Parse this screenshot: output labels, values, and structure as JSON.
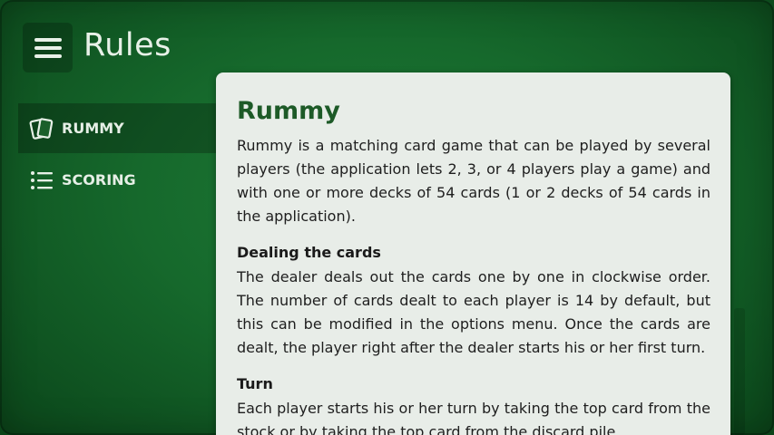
{
  "header": {
    "menu_icon": "hamburger-icon",
    "title": "Rules"
  },
  "sidebar": {
    "items": [
      {
        "label": "RUMMY",
        "icon": "cards-icon",
        "active": true
      },
      {
        "label": "SCORING",
        "icon": "list-icon",
        "active": false
      }
    ]
  },
  "content": {
    "heading": "Rummy",
    "intro": "Rummy is a matching card game that can be played by several players (the application lets 2, 3, or 4 players play a game) and with one or more decks of 54 cards (1 or 2 decks of 54 cards in the application).",
    "sections": [
      {
        "title": "Dealing the cards",
        "text": "The dealer deals out the cards one by one in clockwise order. The number of cards dealt to each player is 14 by default, but this can be modified in the options menu. Once the cards are dealt, the player right after the dealer starts his or her first turn."
      },
      {
        "title": "Turn",
        "text": "Each player starts his or her turn by taking the top card from the stock or by taking the top card from the discard pile."
      }
    ]
  },
  "colors": {
    "felt": "#16692c",
    "card_bg": "#e8ede8",
    "heading": "#1d5a27"
  }
}
